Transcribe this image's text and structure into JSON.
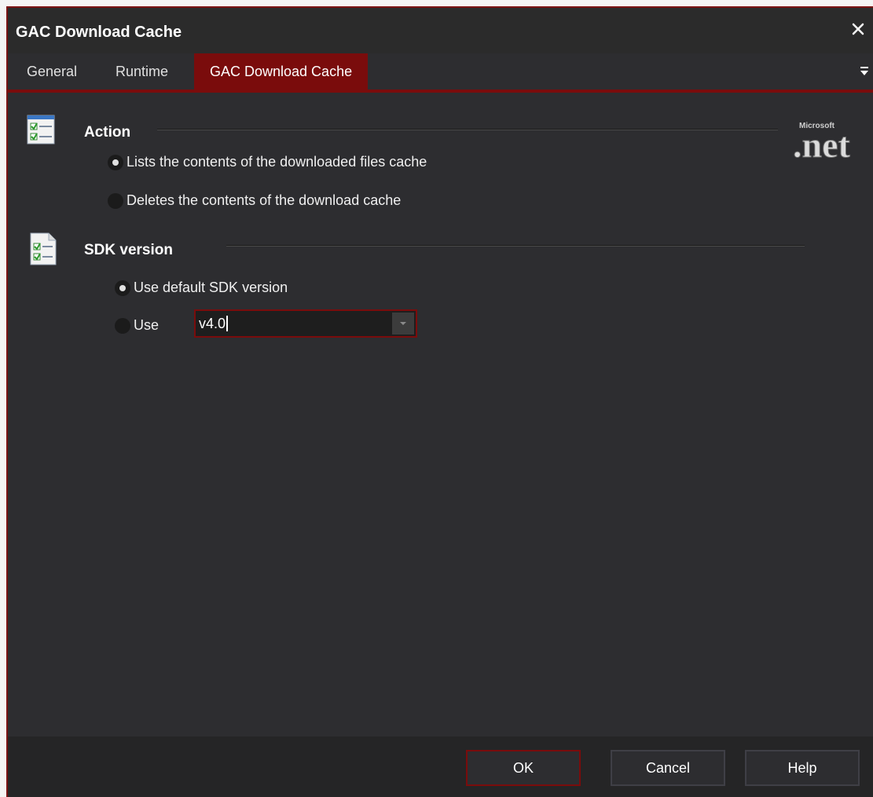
{
  "window": {
    "title": "GAC Download Cache"
  },
  "tabs": [
    {
      "label": "General"
    },
    {
      "label": "Runtime"
    },
    {
      "label": "GAC Download Cache"
    }
  ],
  "sections": {
    "action": {
      "title": "Action",
      "options": [
        {
          "label": "Lists the contents of the downloaded files cache",
          "checked": true
        },
        {
          "label": "Deletes the contents of the download cache",
          "checked": false
        }
      ]
    },
    "sdk": {
      "title": "SDK version",
      "options": [
        {
          "label": "Use default SDK version",
          "checked": true
        },
        {
          "label": "Use",
          "checked": false
        }
      ],
      "version_value": "v4.0"
    }
  },
  "logo": {
    "name": "microsoft-dotnet-logo",
    "text_small": "Microsoft",
    "text_large": ".net"
  },
  "buttons": {
    "ok": "OK",
    "cancel": "Cancel",
    "help": "Help"
  },
  "colors": {
    "accent": "#7a0c0c",
    "background": "#2d2d30",
    "footer": "#252526"
  }
}
